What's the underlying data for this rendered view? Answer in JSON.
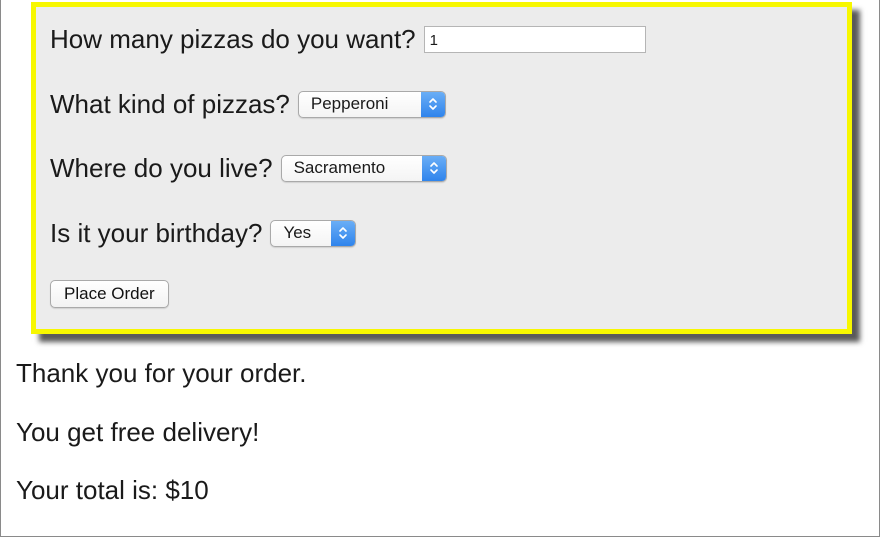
{
  "form": {
    "quantity": {
      "question": "How many pizzas do you want?",
      "value": "1"
    },
    "kind": {
      "question": "What kind of pizzas?",
      "selected": "Pepperoni"
    },
    "location": {
      "question": "Where do you live?",
      "selected": "Sacramento"
    },
    "birthday": {
      "question": "Is it your birthday?",
      "selected": "Yes"
    },
    "submit_label": "Place Order"
  },
  "results": {
    "thanks": "Thank you for your order.",
    "delivery": "You get free delivery!",
    "total": "Your total is: $10"
  },
  "colors": {
    "form_border": "#f7f700",
    "form_background": "#ececec",
    "select_arrow": "#2f84ec"
  },
  "icons": {
    "select_arrow": "up-down-chevron-icon"
  }
}
